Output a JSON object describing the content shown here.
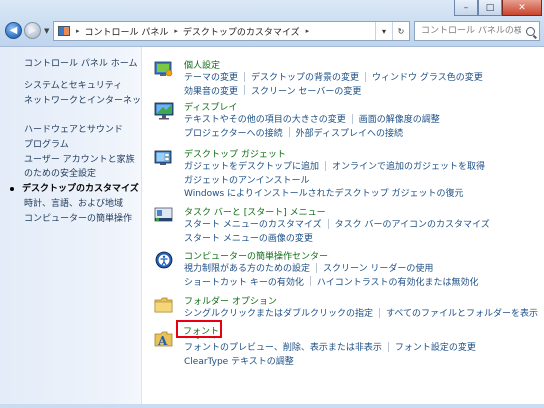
{
  "window": {
    "controls": {
      "minimize": "–",
      "maximize": "□",
      "close": "✕"
    }
  },
  "address": {
    "segments": [
      "コントロール パネル",
      "デスクトップのカスタマイズ"
    ],
    "separator": "▸"
  },
  "search": {
    "placeholder": "コントロール パネルの検索"
  },
  "sidebar": {
    "items": [
      {
        "label": "コントロール パネル ホーム"
      },
      {
        "label": "システムとセキュリティ"
      },
      {
        "label": "ネットワークとインターネット"
      },
      {
        "label": "ハードウェアとサウンド"
      },
      {
        "label": "プログラム"
      },
      {
        "label": "ユーザー アカウントと家族"
      },
      {
        "label": "のための安全設定"
      },
      {
        "label": "デスクトップのカスタマイズ"
      },
      {
        "label": "時計、言語、および地域"
      },
      {
        "label": "コンピューターの簡単操作"
      }
    ]
  },
  "categories": [
    {
      "title": "個人設定",
      "rows": [
        [
          "テーマの変更",
          "デスクトップの背景の変更",
          "ウィンドウ グラス色の変更"
        ],
        [
          "効果音の変更",
          "スクリーン セーバーの変更"
        ]
      ]
    },
    {
      "title": "ディスプレイ",
      "rows": [
        [
          "テキストやその他の項目の大きさの変更",
          "画面の解像度の調整"
        ],
        [
          "プロジェクターへの接続",
          "外部ディスプレイへの接続"
        ]
      ]
    },
    {
      "title": "デスクトップ ガジェット",
      "rows": [
        [
          "ガジェットをデスクトップに追加",
          "オンラインで追加のガジェットを取得"
        ],
        [
          "ガジェットのアンインストール"
        ],
        [
          "Windows によりインストールされたデスクトップ ガジェットの復元"
        ]
      ]
    },
    {
      "title": "タスク バーと [スタート] メニュー",
      "rows": [
        [
          "スタート メニューのカスタマイズ",
          "タスク バーのアイコンのカスタマイズ"
        ],
        [
          "スタート メニューの画像の変更"
        ]
      ]
    },
    {
      "title": "コンピューターの簡単操作センター",
      "rows": [
        [
          "視力制限がある方のための設定",
          "スクリーン リーダーの使用"
        ],
        [
          "ショートカット キーの有効化",
          "ハイコントラストの有効化または無効化"
        ]
      ]
    },
    {
      "title": "フォルダー オプション",
      "rows": [
        [
          "シングルクリックまたはダブルクリックの指定",
          "すべてのファイルとフォルダーを表示"
        ]
      ]
    },
    {
      "title": "フォント",
      "rows": [
        [
          "フォントのプレビュー、削除、表示または非表示",
          "フォント設定の変更"
        ],
        [
          "ClearType テキストの調整"
        ]
      ]
    }
  ],
  "colors": {
    "highlight_box": "#e60012",
    "category_title": "#0e6d13",
    "link": "#1d4f85"
  }
}
